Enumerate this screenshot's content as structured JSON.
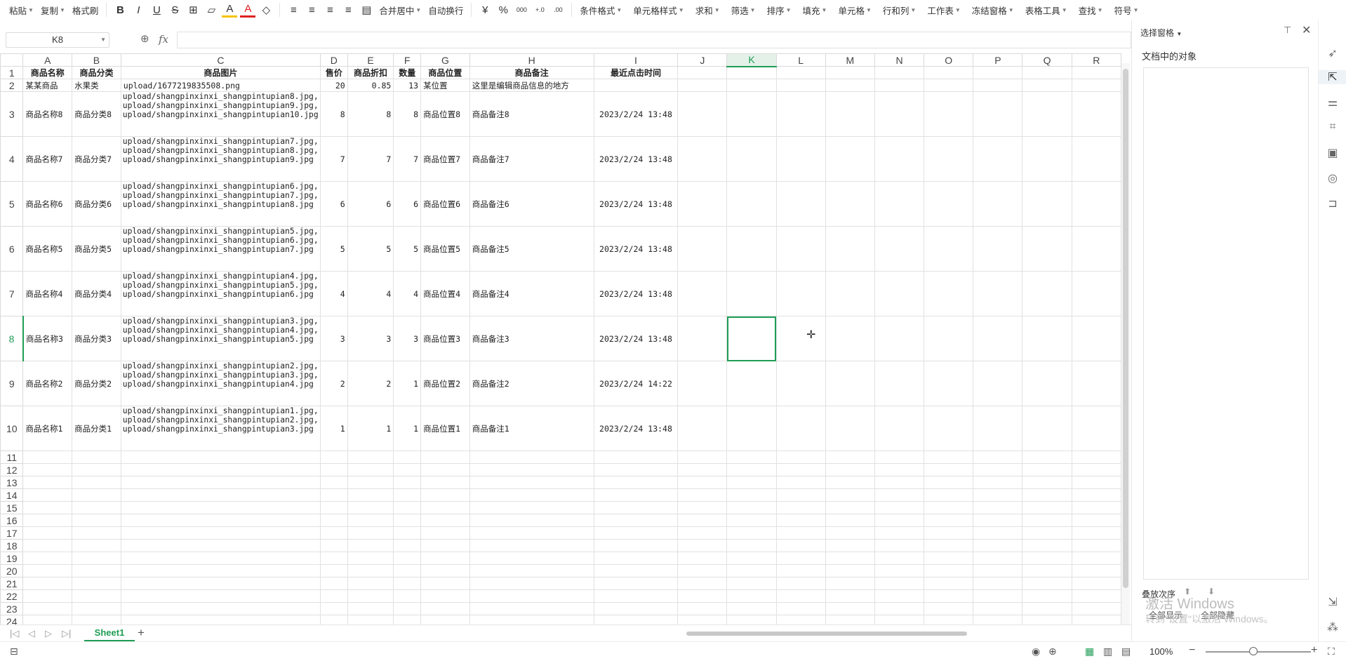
{
  "ribbon": {
    "groups": [
      {
        "label": "粘贴",
        "arrow": true
      },
      {
        "label": "复制",
        "arrow": true,
        "icon": "copy-icon"
      },
      {
        "label": "格式刷",
        "arrow": false
      }
    ],
    "format_icons": [
      "B",
      "I",
      "U",
      "S",
      "⊞",
      "▱",
      "A",
      "A",
      "◇"
    ],
    "align_icons": [
      "≡",
      "≡",
      "≡",
      "≡",
      "▤"
    ],
    "merge_label": "合并居中",
    "wrap_label": "自动换行",
    "number_icons": [
      "¥",
      "%",
      "000",
      "+.0",
      ".00"
    ],
    "right_groups": [
      {
        "label": "条件格式"
      },
      {
        "label": "单元格样式"
      },
      {
        "label": "求和"
      },
      {
        "label": "筛选"
      },
      {
        "label": "排序"
      },
      {
        "label": "填充"
      },
      {
        "label": "单元格"
      },
      {
        "label": "行和列"
      },
      {
        "label": "工作表"
      },
      {
        "label": "冻结窗格"
      },
      {
        "label": "表格工具"
      },
      {
        "label": "查找"
      },
      {
        "label": "符号"
      }
    ]
  },
  "formula_bar": {
    "name_box": "K8",
    "fx_label": "fx",
    "formula": ""
  },
  "columns": [
    {
      "key": "A",
      "w": 70
    },
    {
      "key": "B",
      "w": 70
    },
    {
      "key": "C",
      "w": 288
    },
    {
      "key": "D",
      "w": 39
    },
    {
      "key": "E",
      "w": 66
    },
    {
      "key": "F",
      "w": 39
    },
    {
      "key": "G",
      "w": 70
    },
    {
      "key": "H",
      "w": 178
    },
    {
      "key": "I",
      "w": 120
    },
    {
      "key": "J",
      "w": 72
    },
    {
      "key": "K",
      "w": 72
    },
    {
      "key": "L",
      "w": 72
    },
    {
      "key": "M",
      "w": 72
    },
    {
      "key": "N",
      "w": 72
    },
    {
      "key": "O",
      "w": 72
    },
    {
      "key": "P",
      "w": 72
    },
    {
      "key": "Q",
      "w": 72
    },
    {
      "key": "R",
      "w": 72
    }
  ],
  "selected_cell": {
    "col": "K",
    "row": 8
  },
  "header_row": [
    "商品名称",
    "商品分类",
    "商品图片",
    "售价",
    "商品折扣",
    "数量",
    "商品位置",
    "商品备注",
    "最近点击时间"
  ],
  "rows": [
    {
      "n": 2,
      "h": 18,
      "cells": [
        "某某商品",
        "水果类",
        "upload/1677219835508.png",
        "20",
        "0.85",
        "13",
        "某位置",
        "这里是编辑商品信息的地方",
        ""
      ]
    },
    {
      "n": 3,
      "h": 64,
      "cells": [
        "商品名称8",
        "商品分类8",
        "upload/shangpinxinxi_shangpintupian8.jpg,upload/shangpinxinxi_shangpintupian9.jpg,upload/shangpinxinxi_shangpintupian10.jpg",
        "8",
        "8",
        "8",
        "商品位置8",
        "商品备注8",
        "2023/2/24 13:48"
      ]
    },
    {
      "n": 4,
      "h": 64,
      "cells": [
        "商品名称7",
        "商品分类7",
        "upload/shangpinxinxi_shangpintupian7.jpg,upload/shangpinxinxi_shangpintupian8.jpg,upload/shangpinxinxi_shangpintupian9.jpg",
        "7",
        "7",
        "7",
        "商品位置7",
        "商品备注7",
        "2023/2/24 13:48"
      ]
    },
    {
      "n": 5,
      "h": 64,
      "cells": [
        "商品名称6",
        "商品分类6",
        "upload/shangpinxinxi_shangpintupian6.jpg,upload/shangpinxinxi_shangpintupian7.jpg,upload/shangpinxinxi_shangpintupian8.jpg",
        "6",
        "6",
        "6",
        "商品位置6",
        "商品备注6",
        "2023/2/24 13:48"
      ]
    },
    {
      "n": 6,
      "h": 64,
      "cells": [
        "商品名称5",
        "商品分类5",
        "upload/shangpinxinxi_shangpintupian5.jpg,upload/shangpinxinxi_shangpintupian6.jpg,upload/shangpinxinxi_shangpintupian7.jpg",
        "5",
        "5",
        "5",
        "商品位置5",
        "商品备注5",
        "2023/2/24 13:48"
      ]
    },
    {
      "n": 7,
      "h": 64,
      "cells": [
        "商品名称4",
        "商品分类4",
        "upload/shangpinxinxi_shangpintupian4.jpg,upload/shangpinxinxi_shangpintupian5.jpg,upload/shangpinxinxi_shangpintupian6.jpg",
        "4",
        "4",
        "4",
        "商品位置4",
        "商品备注4",
        "2023/2/24 13:48"
      ]
    },
    {
      "n": 8,
      "h": 64,
      "cells": [
        "商品名称3",
        "商品分类3",
        "upload/shangpinxinxi_shangpintupian3.jpg,upload/shangpinxinxi_shangpintupian4.jpg,upload/shangpinxinxi_shangpintupian5.jpg",
        "3",
        "3",
        "3",
        "商品位置3",
        "商品备注3",
        "2023/2/24 13:48"
      ]
    },
    {
      "n": 9,
      "h": 64,
      "cells": [
        "商品名称2",
        "商品分类2",
        "upload/shangpinxinxi_shangpintupian2.jpg,upload/shangpinxinxi_shangpintupian3.jpg,upload/shangpinxinxi_shangpintupian4.jpg",
        "2",
        "2",
        "1",
        "商品位置2",
        "商品备注2",
        "2023/2/24 14:22"
      ]
    },
    {
      "n": 10,
      "h": 64,
      "cells": [
        "商品名称1",
        "商品分类1",
        "upload/shangpinxinxi_shangpintupian1.jpg,upload/shangpinxinxi_shangpintupian2.jpg,upload/shangpinxinxi_shangpintupian3.jpg",
        "1",
        "1",
        "1",
        "商品位置1",
        "商品备注1",
        "2023/2/24 13:48"
      ]
    }
  ],
  "empty_rows": [
    11,
    12,
    13,
    14,
    15,
    16,
    17,
    18,
    19,
    20,
    21,
    22,
    23,
    24
  ],
  "sheet_tabs": {
    "active": "Sheet1",
    "add": "+"
  },
  "status": {
    "zoom": "100%",
    "zoom_minus": "−",
    "zoom_plus": "+"
  },
  "pane": {
    "title": "选择窗格",
    "sub": "文档中的对象",
    "order_label": "叠放次序",
    "show_all": "全部显示",
    "hide_all": "全部隐藏"
  },
  "watermark": {
    "line1": "激活 Windows",
    "line2": "转到\"设置\"以激活 Windows。"
  },
  "colors": {
    "accent": "#1f9d55",
    "grid": "#e1e1e1"
  }
}
